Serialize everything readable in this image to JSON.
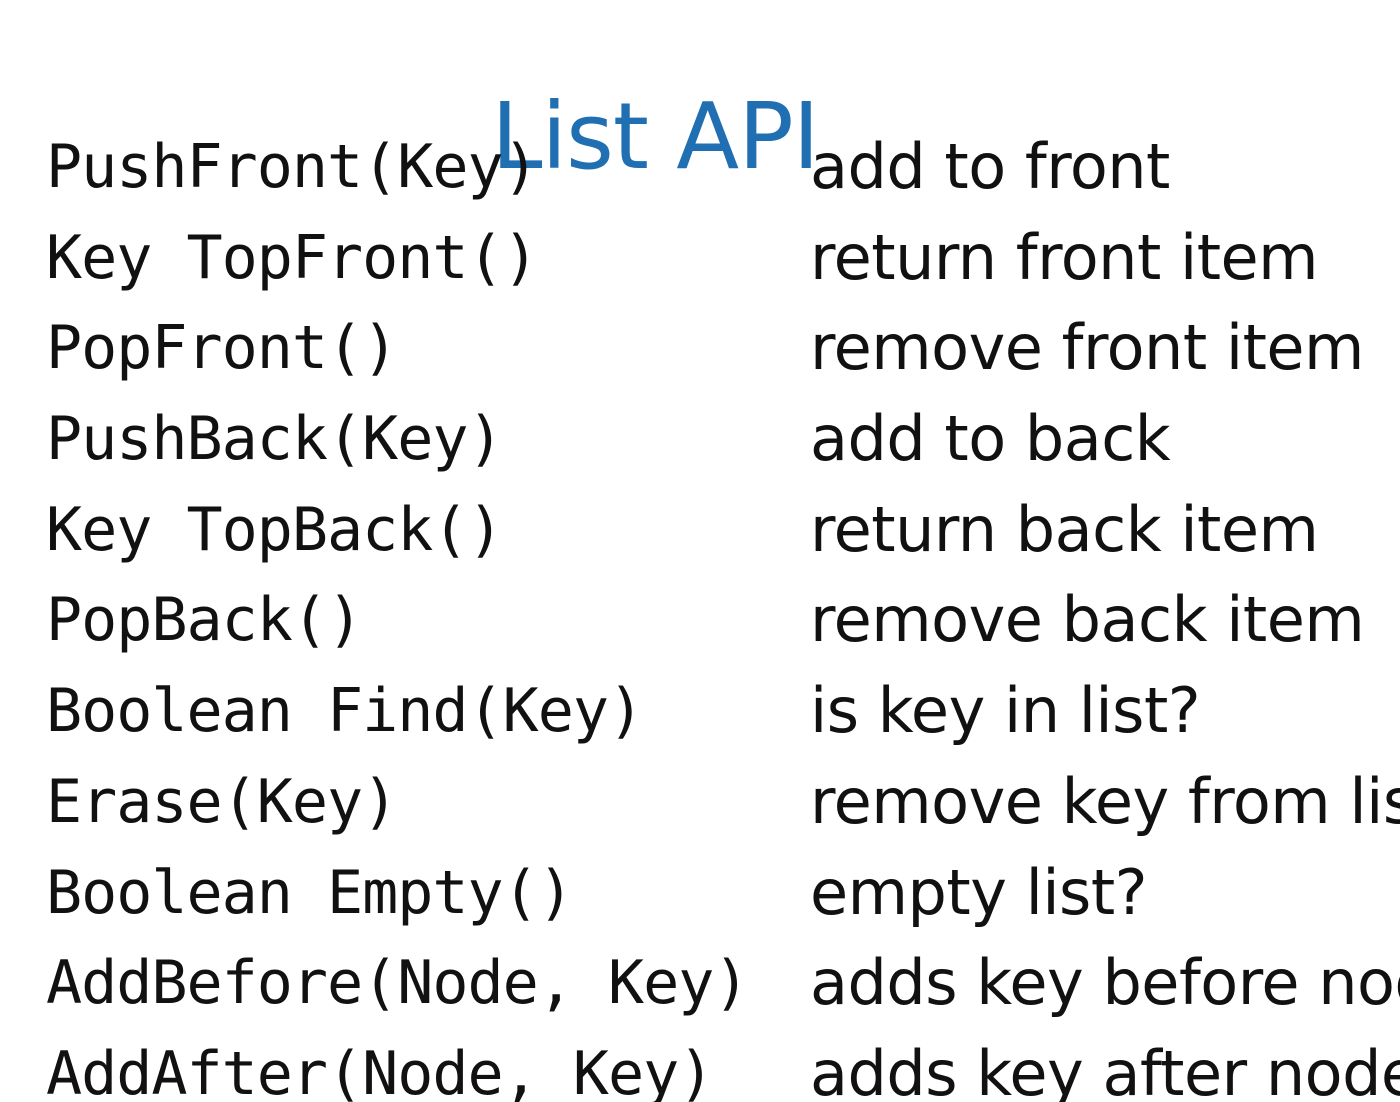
{
  "title": "List API",
  "api": [
    {
      "signature": "PushFront(Key)",
      "description": "add to front"
    },
    {
      "signature": "Key TopFront()",
      "description": "return front item"
    },
    {
      "signature": "PopFront()",
      "description": "remove front item"
    },
    {
      "signature": "PushBack(Key)",
      "description": "add to back"
    },
    {
      "signature": "Key TopBack()",
      "description": "return back item"
    },
    {
      "signature": "PopBack()",
      "description": "remove back item"
    },
    {
      "signature": "Boolean Find(Key)",
      "description": "is key in list?"
    },
    {
      "signature": "Erase(Key)",
      "description": "remove key from list"
    },
    {
      "signature": "Boolean Empty()",
      "description": "empty list?"
    },
    {
      "signature": "AddBefore(Node, Key)",
      "description": "adds key before node"
    },
    {
      "signature": "AddAfter(Node, Key)",
      "description": "adds key after node"
    }
  ]
}
